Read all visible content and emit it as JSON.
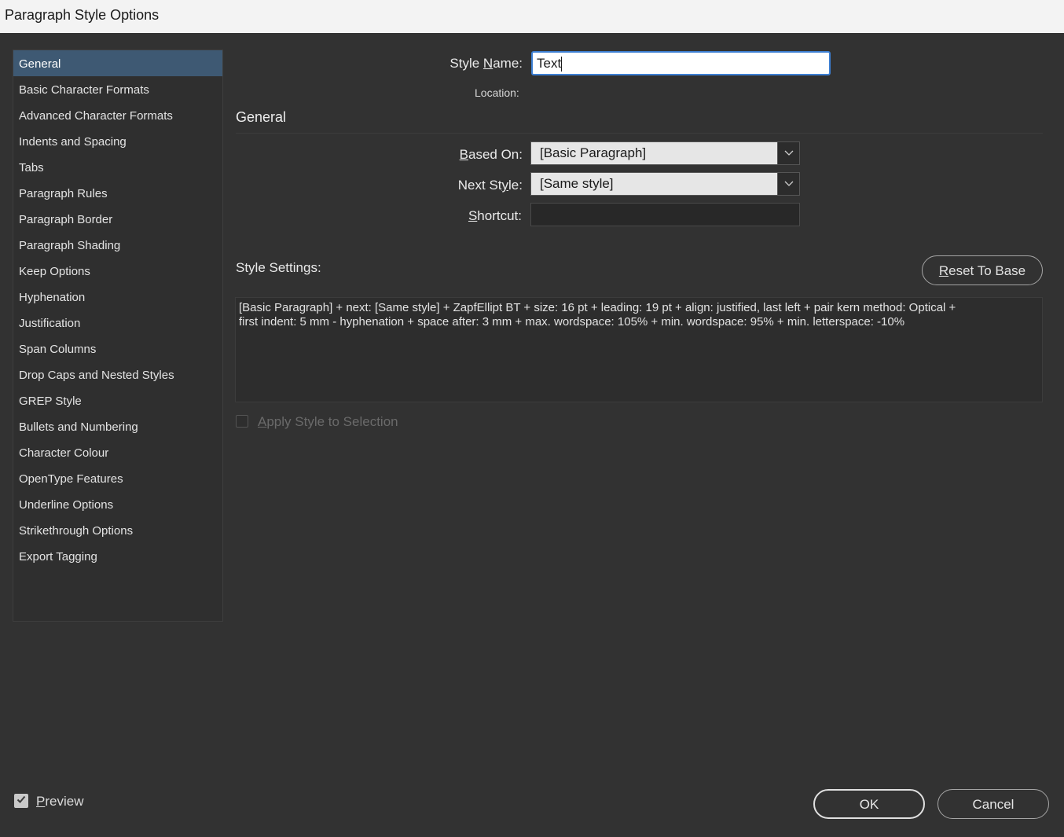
{
  "window": {
    "title": "Paragraph Style Options"
  },
  "sidebar": {
    "items": [
      {
        "label": "General",
        "selected": true
      },
      {
        "label": "Basic Character Formats"
      },
      {
        "label": "Advanced Character Formats"
      },
      {
        "label": "Indents and Spacing"
      },
      {
        "label": "Tabs"
      },
      {
        "label": "Paragraph Rules"
      },
      {
        "label": "Paragraph Border"
      },
      {
        "label": "Paragraph Shading"
      },
      {
        "label": "Keep Options"
      },
      {
        "label": "Hyphenation"
      },
      {
        "label": "Justification"
      },
      {
        "label": "Span Columns"
      },
      {
        "label": "Drop Caps and Nested Styles"
      },
      {
        "label": "GREP Style"
      },
      {
        "label": "Bullets and Numbering"
      },
      {
        "label": "Character Colour"
      },
      {
        "label": "OpenType Features"
      },
      {
        "label": "Underline Options"
      },
      {
        "label": "Strikethrough Options"
      },
      {
        "label": "Export Tagging"
      }
    ]
  },
  "form": {
    "style_name": {
      "label_pre": "Style ",
      "label_key": "N",
      "label_post": "ame:",
      "value": "Text"
    },
    "location": {
      "label": "Location:"
    },
    "section_title": "General",
    "based_on": {
      "label_key": "B",
      "label_post": "ased On:",
      "value": "[Basic Paragraph]"
    },
    "next_style": {
      "label_pre": "Next St",
      "label_key": "y",
      "label_post": "le:",
      "value": "[Same style]"
    },
    "shortcut": {
      "label_key": "S",
      "label_post": "hortcut:",
      "value": ""
    }
  },
  "style_settings": {
    "label": "Style Settings:",
    "reset_pre": "",
    "reset_key": "R",
    "reset_post": "eset To Base",
    "line1": "[Basic Paragraph] + next: [Same style] + ZapfEllipt BT + size: 16 pt + leading: 19 pt + align: justified, last left + pair kern method: Optical +",
    "line2": "first indent: 5 mm - hyphenation + space after: 3 mm + max. wordspace: 105% + min. wordspace: 95% + min. letterspace: -10%"
  },
  "apply_style": {
    "key": "A",
    "rest": "pply Style to Selection",
    "checked": false,
    "enabled": false
  },
  "preview": {
    "key": "P",
    "rest": "review",
    "checked": true
  },
  "buttons": {
    "ok": "OK",
    "cancel": "Cancel"
  },
  "icons": {
    "dropdown": "chevron-down-icon",
    "check": "checkmark-icon"
  },
  "colors": {
    "background": "#323232",
    "selected": "#3e5973",
    "focus": "#3d7fd3"
  }
}
